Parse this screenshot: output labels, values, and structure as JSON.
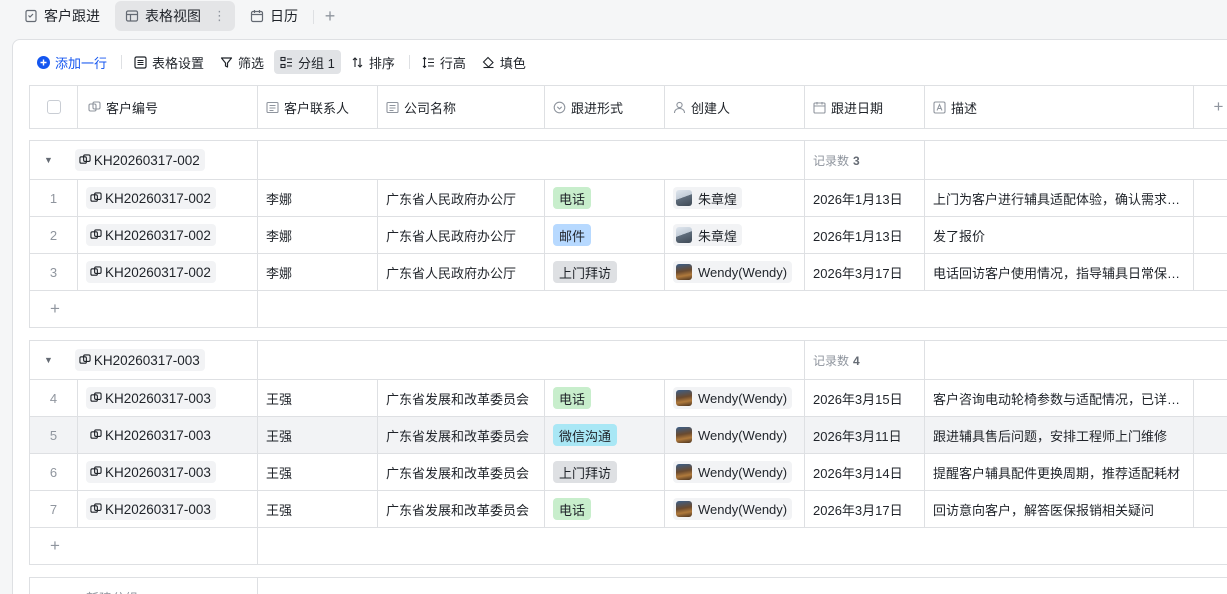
{
  "views": {
    "tabs": [
      {
        "label": "客户跟进",
        "icon": "form-icon"
      },
      {
        "label": "表格视图",
        "icon": "table-icon",
        "active": true
      },
      {
        "label": "日历",
        "icon": "calendar-icon"
      }
    ],
    "more": "⋮",
    "add": "+"
  },
  "toolbar": {
    "add_row": "添加一行",
    "table_settings": "表格设置",
    "filter": "筛选",
    "group": "分组 1",
    "sort": "排序",
    "row_height": "行高",
    "fill": "填色"
  },
  "columns": [
    {
      "label": "客户编号",
      "icon": "link-icon"
    },
    {
      "label": "客户联系人",
      "icon": "text-field-icon"
    },
    {
      "label": "公司名称",
      "icon": "text-field-icon"
    },
    {
      "label": "跟进形式",
      "icon": "single-select-icon"
    },
    {
      "label": "创建人",
      "icon": "person-icon"
    },
    {
      "label": "跟进日期",
      "icon": "date-icon"
    },
    {
      "label": "描述",
      "icon": "text-icon"
    }
  ],
  "add_column": "+",
  "colors": {
    "tag_phone": "#c8eecc",
    "tag_mail": "#b7d9ff",
    "tag_visit": "#dee0e3",
    "tag_wechat": "#a9e7f5",
    "accent": "#1456f0"
  },
  "groups": [
    {
      "key": "KH20260317-002",
      "count_label": "记录数",
      "count": "3",
      "rows": [
        {
          "num": "1",
          "code": "KH20260317-002",
          "contact": "李娜",
          "company": "广东省人民政府办公厅",
          "method": "电话",
          "method_color": "#c8eecc",
          "creator": "朱章煌",
          "avatar": "a",
          "date": "2026年1月13日",
          "desc": "上门为客户进行辅具适配体验，确认需求…"
        },
        {
          "num": "2",
          "code": "KH20260317-002",
          "contact": "李娜",
          "company": "广东省人民政府办公厅",
          "method": "邮件",
          "method_color": "#b7d9ff",
          "creator": "朱章煌",
          "avatar": "a",
          "date": "2026年1月13日",
          "desc": "发了报价"
        },
        {
          "num": "3",
          "code": "KH20260317-002",
          "contact": "李娜",
          "company": "广东省人民政府办公厅",
          "method": "上门拜访",
          "method_color": "#dee0e3",
          "creator": "Wendy(Wendy)",
          "avatar": "w",
          "date": "2026年3月17日",
          "desc": "电话回访客户使用情况，指导辅具日常保…"
        }
      ]
    },
    {
      "key": "KH20260317-003",
      "count_label": "记录数",
      "count": "4",
      "rows": [
        {
          "num": "4",
          "code": "KH20260317-003",
          "contact": "王强",
          "company": "广东省发展和改革委员会",
          "method": "电话",
          "method_color": "#c8eecc",
          "creator": "Wendy(Wendy)",
          "avatar": "w",
          "date": "2026年3月15日",
          "desc": "客户咨询电动轮椅参数与适配情况，已详…"
        },
        {
          "num": "5",
          "code": "KH20260317-003",
          "contact": "王强",
          "company": "广东省发展和改革委员会",
          "method": "微信沟通",
          "method_color": "#a9e7f5",
          "creator": "Wendy(Wendy)",
          "avatar": "w",
          "date": "2026年3月11日",
          "desc": "跟进辅具售后问题，安排工程师上门维修",
          "highlight": true
        },
        {
          "num": "6",
          "code": "KH20260317-003",
          "contact": "王强",
          "company": "广东省发展和改革委员会",
          "method": "上门拜访",
          "method_color": "#dee0e3",
          "creator": "Wendy(Wendy)",
          "avatar": "w",
          "date": "2026年3月14日",
          "desc": "提醒客户辅具配件更换周期，推荐适配耗材"
        },
        {
          "num": "7",
          "code": "KH20260317-003",
          "contact": "王强",
          "company": "广东省发展和改革委员会",
          "method": "电话",
          "method_color": "#c8eecc",
          "creator": "Wendy(Wendy)",
          "avatar": "w",
          "date": "2026年3月17日",
          "desc": "回访意向客户，解答医保报销相关疑问"
        }
      ]
    }
  ],
  "add_record": "+",
  "new_group": "新建分组"
}
